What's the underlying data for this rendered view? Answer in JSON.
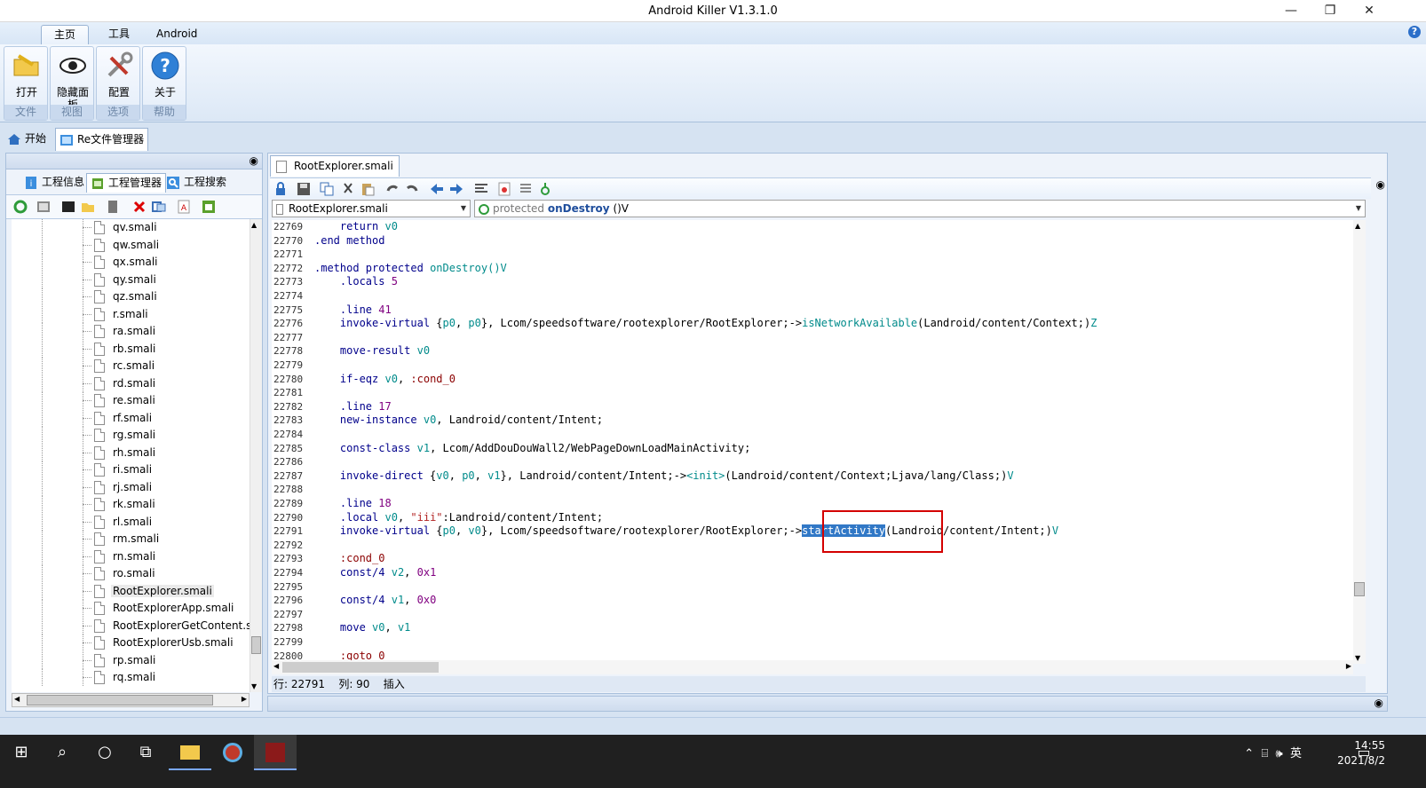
{
  "window": {
    "title": "Android Killer V1.3.1.0"
  },
  "ribbon_tabs": [
    "主页",
    "工具",
    "Android"
  ],
  "ribbon": {
    "open": "打开",
    "hide_panel": "隐藏面板",
    "config": "配置",
    "about": "关于",
    "groups": {
      "file": "文件",
      "view": "视图",
      "options": "选项",
      "help": "帮助"
    }
  },
  "doc_tabs": {
    "start": "开始",
    "re_manager": "Re文件管理器"
  },
  "left_panel": {
    "tabs": [
      "工程信息",
      "工程管理器",
      "工程搜索"
    ],
    "tree_items": [
      "qv.smali",
      "qw.smali",
      "qx.smali",
      "qy.smali",
      "qz.smali",
      "r.smali",
      "ra.smali",
      "rb.smali",
      "rc.smali",
      "rd.smali",
      "re.smali",
      "rf.smali",
      "rg.smali",
      "rh.smali",
      "ri.smali",
      "rj.smali",
      "rk.smali",
      "rl.smali",
      "rm.smali",
      "rn.smali",
      "ro.smali",
      "RootExplorer.smali",
      "RootExplorerApp.smali",
      "RootExplorerGetContent.s",
      "RootExplorerUsb.smali",
      "rp.smali",
      "rq.smali"
    ]
  },
  "editor": {
    "tab_label": "RootExplorer.smali",
    "file_combo": "RootExplorer.smali",
    "method_combo": {
      "modifier": "protected",
      "name": "onDestroy",
      "sig": "()V"
    },
    "status": {
      "line": "行: 22791",
      "col": "列: 90",
      "mode": "插入"
    }
  },
  "code_lines": [
    {
      "num": "22769",
      "html": "    <span class='k'>return</span> <span class='v'>v0</span>"
    },
    {
      "num": "22770",
      "html": "<span class='k'>.end method</span>"
    },
    {
      "num": "22771",
      "html": ""
    },
    {
      "num": "22772",
      "html": "<span class='k'>.method protected</span> <span class='m'>onDestroy</span><span class='m'>()V</span>"
    },
    {
      "num": "22773",
      "html": "    <span class='k'>.locals</span> <span class='n'>5</span>"
    },
    {
      "num": "22774",
      "html": ""
    },
    {
      "num": "22775",
      "html": "    <span class='k'>.line</span> <span class='n'>41</span>"
    },
    {
      "num": "22776",
      "html": "    <span class='k'>invoke-virtual</span> {<span class='v'>p0</span>, <span class='v'>p0</span>}, Lcom/speedsoftware/rootexplorer/RootExplorer;-&gt;<span class='m'>isNetworkAvailable</span>(Landroid/content/Context;)<span class='m'>Z</span>"
    },
    {
      "num": "22777",
      "html": ""
    },
    {
      "num": "22778",
      "html": "    <span class='k'>move-result</span> <span class='v'>v0</span>"
    },
    {
      "num": "22779",
      "html": ""
    },
    {
      "num": "22780",
      "html": "    <span class='k'>if-eqz</span> <span class='v'>v0</span>, <span class='lbl'>:cond_0</span>"
    },
    {
      "num": "22781",
      "html": ""
    },
    {
      "num": "22782",
      "html": "    <span class='k'>.line</span> <span class='n'>17</span>"
    },
    {
      "num": "22783",
      "html": "    <span class='k'>new-instance</span> <span class='v'>v0</span>, Landroid/content/Intent;"
    },
    {
      "num": "22784",
      "html": ""
    },
    {
      "num": "22785",
      "html": "    <span class='k'>const-class</span> <span class='v'>v1</span>, Lcom/AddDouDouWall2/WebPageDownLoadMainActivity;"
    },
    {
      "num": "22786",
      "html": ""
    },
    {
      "num": "22787",
      "html": "    <span class='k'>invoke-direct</span> {<span class='v'>v0</span>, <span class='v'>p0</span>, <span class='v'>v1</span>}, Landroid/content/Intent;-&gt;<span class='m'>&lt;init&gt;</span>(Landroid/content/Context;Ljava/lang/Class;)<span class='m'>V</span>"
    },
    {
      "num": "22788",
      "html": ""
    },
    {
      "num": "22789",
      "html": "    <span class='k'>.line</span> <span class='n'>18</span>"
    },
    {
      "num": "22790",
      "html": "    <span class='k'>.local</span> <span class='v'>v0</span>, <span class='s'>\"iii\"</span>:Landroid/content/Intent;"
    },
    {
      "num": "22791",
      "html": "    <span class='k'>invoke-virtual</span> {<span class='v'>p0</span>, <span class='v'>v0</span>}, Lcom/speedsoftware/rootexplorer/RootExplorer;-&gt;<span class='hilite'>startActivity</span>(Landroid/content/Intent;)<span class='m'>V</span>"
    },
    {
      "num": "22792",
      "html": ""
    },
    {
      "num": "22793",
      "html": "    <span class='lbl'>:cond_0</span>"
    },
    {
      "num": "22794",
      "html": "    <span class='k'>const/4</span> <span class='v'>v2</span>, <span class='n'>0x1</span>"
    },
    {
      "num": "22795",
      "html": ""
    },
    {
      "num": "22796",
      "html": "    <span class='k'>const/4</span> <span class='v'>v1</span>, <span class='n'>0x0</span>"
    },
    {
      "num": "22797",
      "html": ""
    },
    {
      "num": "22798",
      "html": "    <span class='k'>move</span> <span class='v'>v0</span>, <span class='v'>v1</span>"
    },
    {
      "num": "22799",
      "html": ""
    },
    {
      "num": "22800",
      "html": "    <span class='lbl'>:goto_0</span>"
    }
  ],
  "taskbar": {
    "time": "14:55",
    "date": "2021/8/2",
    "ime": "英"
  }
}
